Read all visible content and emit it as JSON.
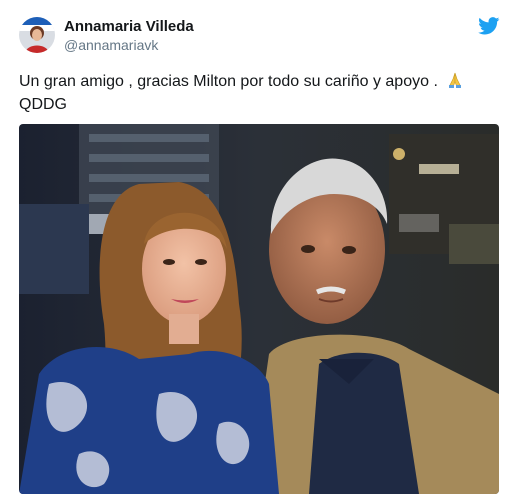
{
  "tweet": {
    "author": {
      "display_name": "Annamaria Villeda",
      "handle": "@annamariavk"
    },
    "text_main": "Un gran amigo , gracias Milton por todo su cariño y apoyo .",
    "text_tail": "QDDG",
    "emoji": "praying-hands-icon"
  },
  "icons": {
    "platform": "twitter-bird-icon"
  },
  "colors": {
    "brand": "#1da1f2",
    "name": "#14171a",
    "handle": "#657786"
  }
}
